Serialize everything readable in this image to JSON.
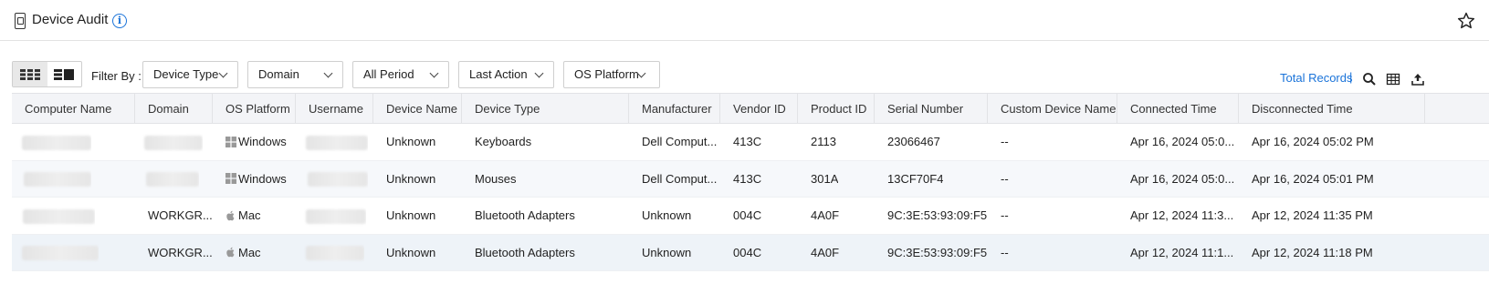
{
  "header": {
    "title": "Device Audit",
    "info_icon": "info-icon",
    "favorite_icon": "star-icon"
  },
  "filters": {
    "label": "Filter By :",
    "view_toggles": [
      "grid-view-icon",
      "list-view-icon"
    ],
    "dropdowns": [
      "Device Type",
      "Domain",
      "All Period",
      "Last Action",
      "OS Platform"
    ]
  },
  "toolbar": {
    "total_records_label": "Total Records",
    "separator": "|",
    "icons": [
      "search-icon",
      "column-chooser-icon",
      "export-icon"
    ]
  },
  "table": {
    "columns": [
      "Computer Name",
      "Domain",
      "OS Platform",
      "Username",
      "Device Name",
      "Device Type",
      "Manufacturer",
      "Vendor ID",
      "Product ID",
      "Serial Number",
      "Custom Device Name",
      "Connected Time",
      "Disconnected Time"
    ],
    "rows": [
      {
        "computer_name": "",
        "domain": "",
        "os_platform": "Windows",
        "os_icon": "windows-icon",
        "username": "",
        "device_name": "Unknown",
        "device_type": "Keyboards",
        "manufacturer": "Dell Comput...",
        "vendor_id": "413C",
        "product_id": "2113",
        "serial_number": "23066467",
        "custom_device_name": "--",
        "connected_time": "Apr 16, 2024 05:0...",
        "disconnected_time": "Apr 16, 2024 05:02 PM"
      },
      {
        "computer_name": "",
        "domain": "",
        "os_platform": "Windows",
        "os_icon": "windows-icon",
        "username": "",
        "device_name": "Unknown",
        "device_type": "Mouses",
        "manufacturer": "Dell Comput...",
        "vendor_id": "413C",
        "product_id": "301A",
        "serial_number": "13CF70F4",
        "custom_device_name": "--",
        "connected_time": "Apr 16, 2024 05:0...",
        "disconnected_time": "Apr 16, 2024 05:01 PM"
      },
      {
        "computer_name": "",
        "domain": "WORKGR...",
        "os_platform": "Mac",
        "os_icon": "apple-icon",
        "username": "",
        "device_name": "Unknown",
        "device_type": "Bluetooth Adapters",
        "manufacturer": "Unknown",
        "vendor_id": "004C",
        "product_id": "4A0F",
        "serial_number": "9C:3E:53:93:09:F5",
        "custom_device_name": "--",
        "connected_time": "Apr 12, 2024 11:3...",
        "disconnected_time": "Apr 12, 2024 11:35 PM"
      },
      {
        "computer_name": "",
        "domain": "WORKGR...",
        "os_platform": "Mac",
        "os_icon": "apple-icon",
        "username": "",
        "device_name": "Unknown",
        "device_type": "Bluetooth Adapters",
        "manufacturer": "Unknown",
        "vendor_id": "004C",
        "product_id": "4A0F",
        "serial_number": "9C:3E:53:93:09:F5",
        "custom_device_name": "--",
        "connected_time": "Apr 12, 2024 11:1...",
        "disconnected_time": "Apr 12, 2024 11:18 PM"
      }
    ]
  },
  "colors": {
    "accent": "#1a73d9",
    "header_bg": "#f3f4f7",
    "alt_row_bg": "#f6f8fb",
    "selected_row_bg": "#eef3f8"
  }
}
